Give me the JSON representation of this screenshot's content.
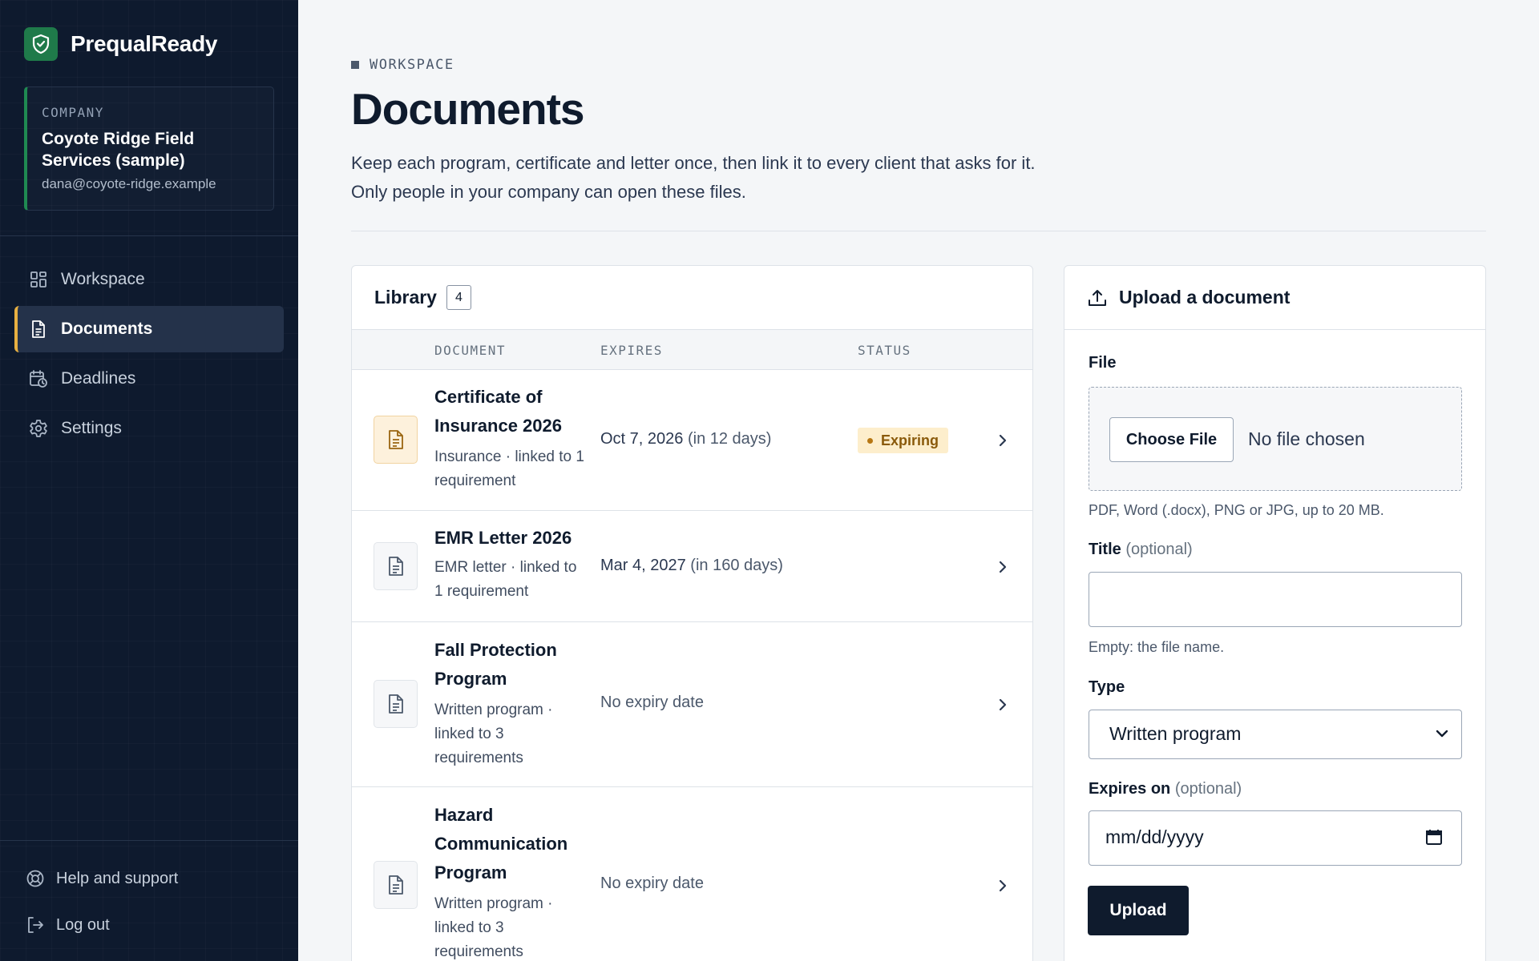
{
  "app": {
    "name": "PrequalReady",
    "logo_icon": "shield-check-icon",
    "brand_color": "#1f7a4a"
  },
  "company": {
    "label": "COMPANY",
    "name": "Coyote Ridge Field Services (sample)",
    "email": "dana@coyote-ridge.example"
  },
  "nav": {
    "items": [
      {
        "label": "Workspace",
        "icon": "grid-icon",
        "active": false
      },
      {
        "label": "Documents",
        "icon": "document-icon",
        "active": true
      },
      {
        "label": "Deadlines",
        "icon": "calendar-clock-icon",
        "active": false
      },
      {
        "label": "Settings",
        "icon": "gear-icon",
        "active": false
      }
    ]
  },
  "bottom_links": {
    "help": {
      "label": "Help and support",
      "icon": "lifebuoy-icon"
    },
    "logout": {
      "label": "Log out",
      "icon": "logout-icon"
    }
  },
  "page": {
    "eyebrow": "WORKSPACE",
    "title": "Documents",
    "description_line1": "Keep each program, certificate and letter once, then link it to every client that asks for it.",
    "description_line2": "Only people in your company can open these files."
  },
  "library": {
    "title": "Library",
    "count": "4",
    "columns": {
      "document": "DOCUMENT",
      "expires": "EXPIRES",
      "status": "STATUS"
    },
    "rows": [
      {
        "title": "Certificate of Insurance 2026",
        "meta": "Insurance · linked to 1 requirement",
        "expires": "Oct 7, 2026",
        "expires_relative": "(in 12 days)",
        "status": "Expiring",
        "status_color": "#8a5a0b"
      },
      {
        "title": "EMR Letter 2026",
        "meta": "EMR letter · linked to 1 requirement",
        "expires": "Mar 4, 2027",
        "expires_relative": "(in 160 days)",
        "status": ""
      },
      {
        "title": "Fall Protection Program",
        "meta": "Written program · linked to 3 requirements",
        "expires": "No expiry date",
        "expires_relative": "",
        "status": ""
      },
      {
        "title": "Hazard Communication Program",
        "meta": "Written program · linked to 3 requirements",
        "expires": "No expiry date",
        "expires_relative": "",
        "status": ""
      }
    ]
  },
  "upload": {
    "title": "Upload a document",
    "icon": "upload-icon",
    "file": {
      "label": "File",
      "button": "Choose File",
      "status": "No file chosen",
      "help": "PDF, Word (.docx), PNG or JPG, up to 20 MB."
    },
    "title_field": {
      "label": "Title",
      "optional": "(optional)",
      "value": "",
      "help": "Empty: the file name."
    },
    "type_field": {
      "label": "Type",
      "value": "Written program"
    },
    "expires_field": {
      "label": "Expires on",
      "optional": "(optional)",
      "placeholder": "mm/dd/yyyy"
    },
    "submit": "Upload"
  }
}
